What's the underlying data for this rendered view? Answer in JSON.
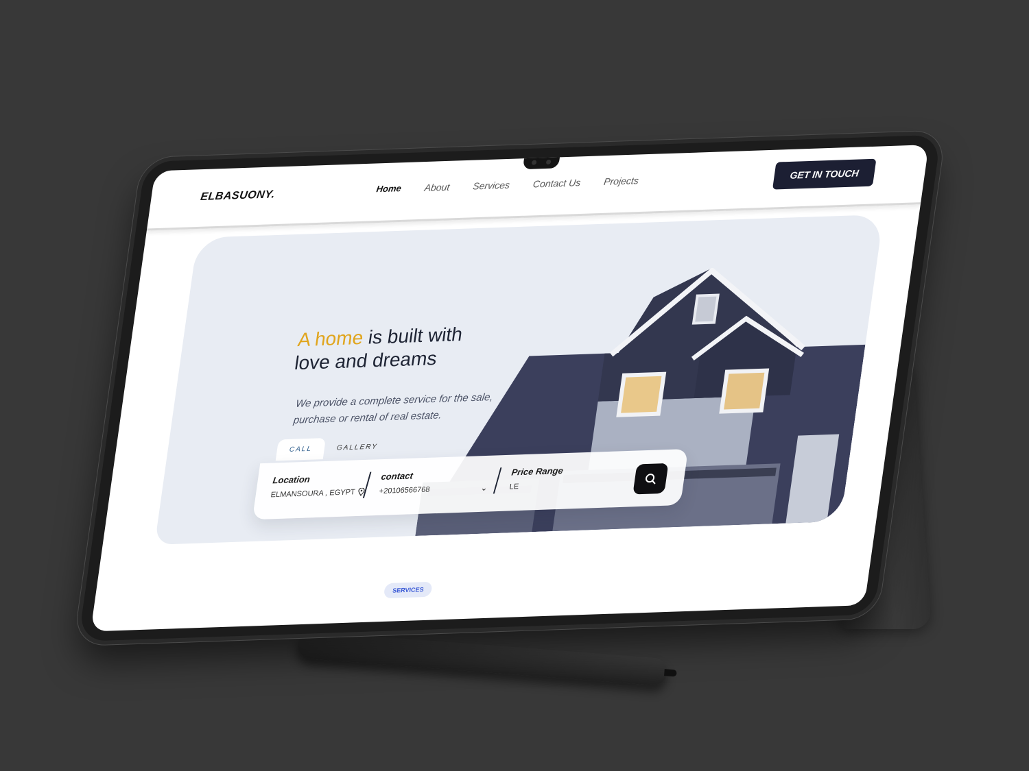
{
  "brand": {
    "logo": "ELBASUONY."
  },
  "nav": {
    "links": [
      "Home",
      "About",
      "Services",
      "Contact Us",
      "Projects"
    ],
    "cta": "GET IN TOUCH"
  },
  "hero": {
    "headline_accent": "A home",
    "headline_rest_1": " is built with",
    "headline_line_2": "love and dreams",
    "subtext": "We provide a complete service for the sale, purchase or rental of real estate.",
    "tabs": [
      "CALL",
      "GALLERY"
    ],
    "search": {
      "location_label": "Location",
      "location_value": "ELMANSOURA , EGYPT",
      "contact_label": "contact",
      "contact_value": "+20106566768",
      "price_label": "Price Range",
      "price_value": "LE"
    }
  },
  "section_pill": "SERVICES",
  "colors": {
    "accent": "#e0a51d",
    "cta_bg": "#1c1f33",
    "hero_bg": "#e8ecf3",
    "house_roof": "#3b3f5c",
    "pill_text": "#3c5bd6"
  },
  "icons": [
    "location-pin-icon",
    "chevron-down-icon",
    "search-icon"
  ]
}
